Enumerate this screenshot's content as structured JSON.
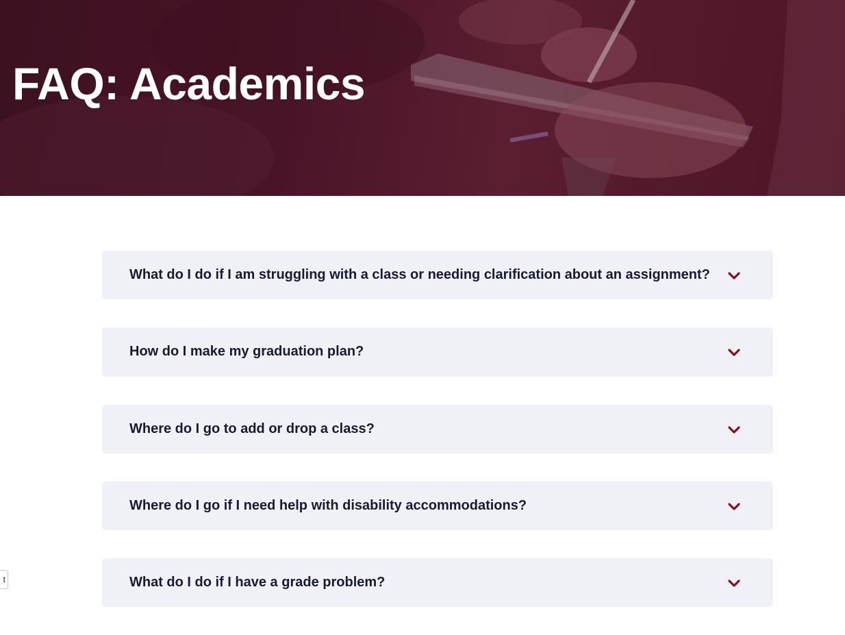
{
  "hero": {
    "title": "FAQ: Academics"
  },
  "faq": {
    "items": [
      {
        "question": "What do I do if I am struggling with a class or needing clarification about an assignment?",
        "icon": "chevron-down-icon"
      },
      {
        "question": "How do I make my graduation plan?",
        "icon": "chevron-down-icon"
      },
      {
        "question": "Where do I go to add or drop a class?",
        "icon": "chevron-down-icon"
      },
      {
        "question": "Where do I go if I need help with disability accommodations?",
        "icon": "chevron-down-icon"
      },
      {
        "question": "What do I do if I have a grade problem?",
        "icon": "chevron-down-icon"
      }
    ]
  },
  "side_tab": {
    "label": "t"
  },
  "colors": {
    "hero_overlay": "#4a1428",
    "accent": "#8a0c1f",
    "card_background": "#f0f1f6",
    "question_text": "#161a33"
  }
}
